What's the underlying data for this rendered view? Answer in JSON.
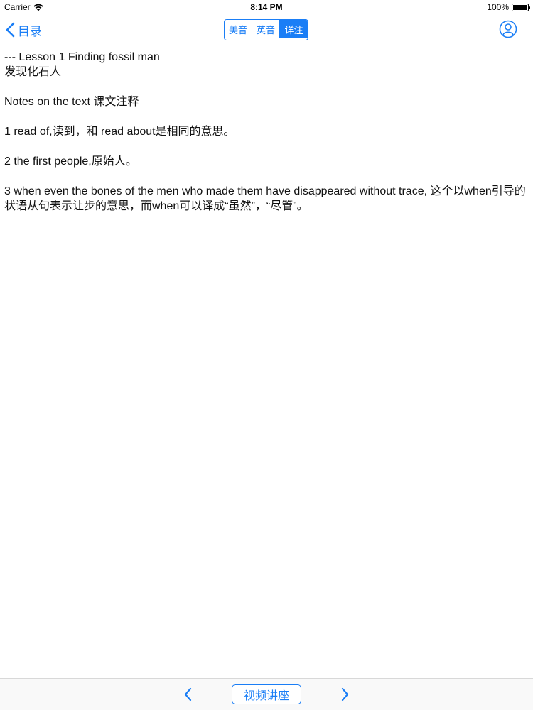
{
  "status_bar": {
    "carrier": "Carrier",
    "time": "8:14 PM",
    "battery": "100%",
    "battery_level": 1.0
  },
  "nav": {
    "back_label": "目录",
    "segments": [
      {
        "label": "美音",
        "selected": false
      },
      {
        "label": "英音",
        "selected": false
      },
      {
        "label": "详注",
        "selected": true
      }
    ],
    "accent_color": "#1a7ef6"
  },
  "content": {
    "title_line": "--- Lesson 1 Finding fossil man",
    "subtitle_line": "发现化石人",
    "notes_heading": "Notes on the text 课文注释",
    "notes": [
      "1 read of,读到，和 read about是相同的意思。",
      "2 the first people,原始人。",
      "3 when even the bones of the men who made them have disappeared without trace, 这个以when引导的状语从句表示让步的意思，而when可以译成“虽然”，“尽管”。"
    ]
  },
  "toolbar": {
    "video_label": "视频讲座",
    "prev_icon": "chevron-left-icon",
    "next_icon": "chevron-right-icon"
  }
}
